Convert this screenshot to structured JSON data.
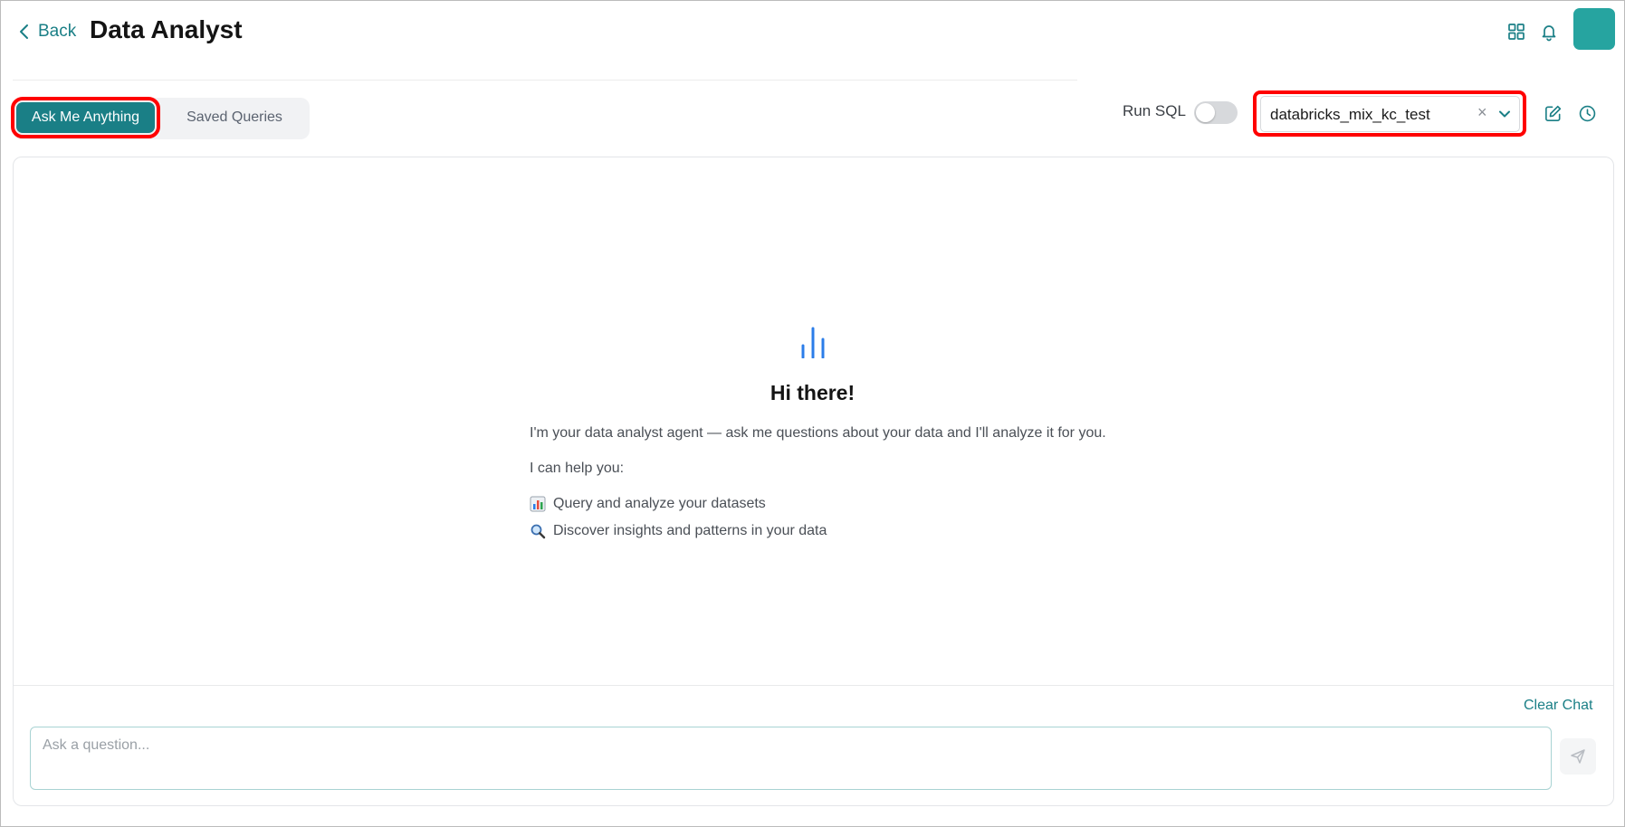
{
  "header": {
    "back_label": "Back",
    "title": "Data Analyst"
  },
  "tabs": [
    {
      "label": "Ask Me Anything",
      "active": true
    },
    {
      "label": "Saved Queries",
      "active": false
    }
  ],
  "controls": {
    "run_sql_label": "Run SQL",
    "run_sql_enabled": false,
    "dataset_value": "databricks_mix_kc_test",
    "clear_symbol": "×"
  },
  "welcome": {
    "greeting": "Hi there!",
    "intro": "I'm your data analyst agent — ask me questions about your data and I'll analyze it for you.",
    "help_heading": "I can help you:",
    "capabilities": [
      {
        "icon": "bar-chart-emoji-icon",
        "text": "Query and analyze your datasets"
      },
      {
        "icon": "magnifier-emoji-icon",
        "text": "Discover insights and patterns in your data"
      }
    ]
  },
  "chat": {
    "clear_label": "Clear Chat",
    "input_placeholder": "Ask a question...",
    "input_value": ""
  },
  "colors": {
    "accent": "#1a7f86",
    "avatar": "#26a4a0",
    "chart_icon": "#2b7de9",
    "highlight": "#ff0000"
  },
  "icons": {
    "header": [
      "grid-icon",
      "bell-icon"
    ],
    "toolbar": [
      "edit-icon",
      "history-icon"
    ],
    "empty_state": "bar-chart-icon",
    "send": "send-icon"
  }
}
